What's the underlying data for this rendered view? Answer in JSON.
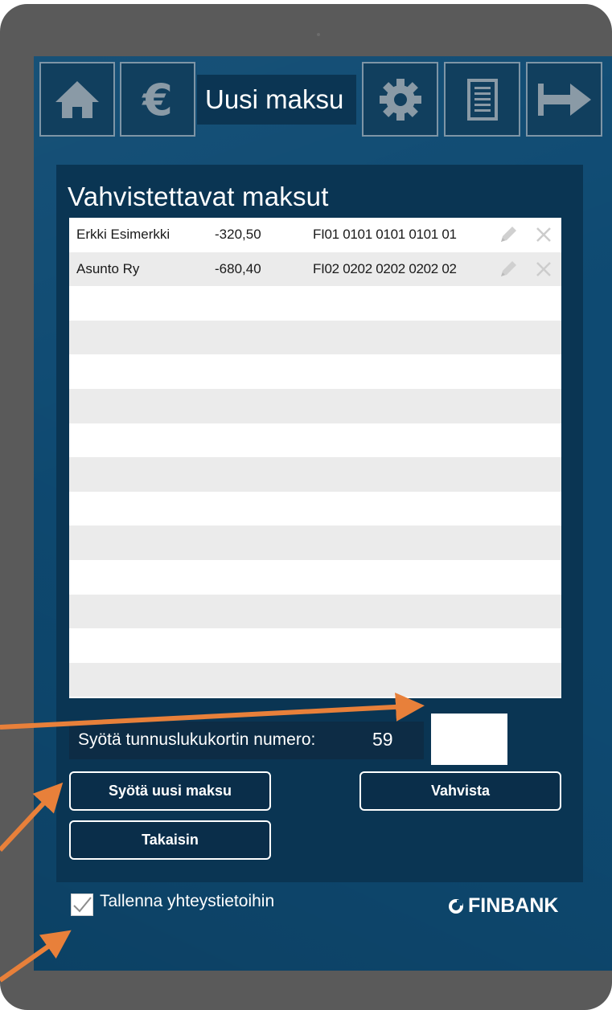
{
  "header": {
    "title": "Uusi maksu",
    "nav": [
      {
        "name": "home",
        "icon": "home-icon"
      },
      {
        "name": "payments",
        "icon": "euro-icon"
      },
      {
        "name": "settings",
        "icon": "gear-icon"
      },
      {
        "name": "statements",
        "icon": "document-icon"
      },
      {
        "name": "logout",
        "icon": "logout-icon"
      }
    ]
  },
  "panel": {
    "title": "Vahvistettavat maksut",
    "payments": [
      {
        "name": "Erkki Esimerkki",
        "amount": "-320,50",
        "iban": "FI01 0101 0101 0101 01"
      },
      {
        "name": "Asunto Ry",
        "amount": "-680,40",
        "iban": "FI02 0202 0202 0202 02"
      }
    ],
    "empty_rows": 12,
    "code_label": "Syötä tunnuslukukortin numero:",
    "code_number": "59",
    "code_value": "",
    "buttons": {
      "new_payment": "Syötä uusi maksu",
      "confirm": "Vahvista",
      "back": "Takaisin"
    }
  },
  "footer": {
    "save_contacts_label": "Tallenna yhteystietoihin",
    "save_contacts_checked": true,
    "brand": "FINBANK"
  },
  "colors": {
    "frame": "#5a5a5a",
    "screen": "#0e4a72",
    "panel": "#0a3553",
    "annotation_arrow": "#e8803a"
  }
}
